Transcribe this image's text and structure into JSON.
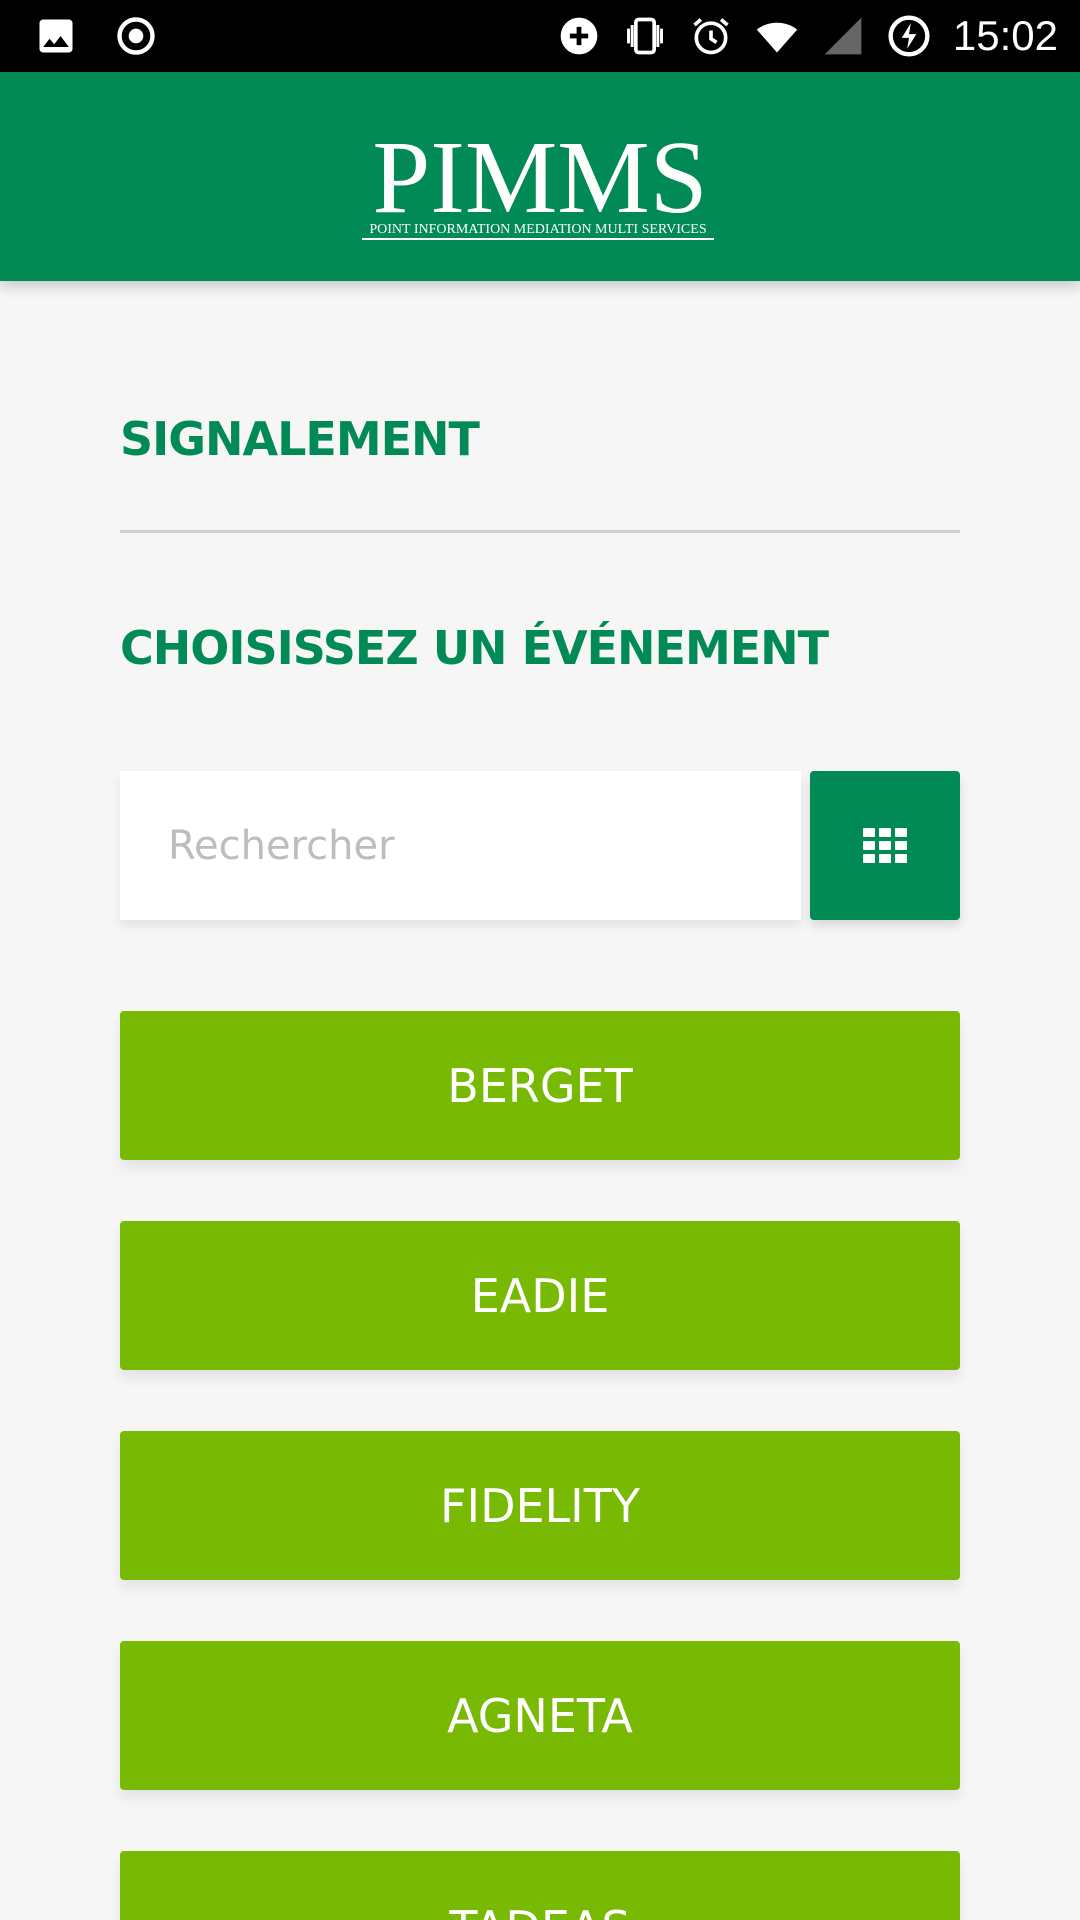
{
  "status_bar": {
    "time": "15:02",
    "left_icons": [
      "image-icon",
      "record-icon"
    ],
    "right_icons": [
      "data-saver-icon",
      "vibrate-icon",
      "alarm-icon",
      "wifi-icon",
      "cell-signal-icon",
      "battery-charging-icon"
    ]
  },
  "header": {
    "logo_title": "PIMMS",
    "logo_subtitle": "POINT INFORMATION MEDIATION MULTI SERVICES"
  },
  "main": {
    "section_title": "SIGNALEMENT",
    "subtitle": "CHOISISSEZ UN ÉVÉNEMENT",
    "search": {
      "placeholder": "Rechercher",
      "value": ""
    },
    "grid_button_icon": "grid-icon",
    "events": [
      {
        "label": "BERGET"
      },
      {
        "label": "EADIE"
      },
      {
        "label": "FIDELITY"
      },
      {
        "label": "AGNETA"
      },
      {
        "label": "TADEAS"
      }
    ]
  },
  "colors": {
    "brand_green": "#018a55",
    "event_green": "#78b904",
    "background": "#f6f6f6"
  }
}
